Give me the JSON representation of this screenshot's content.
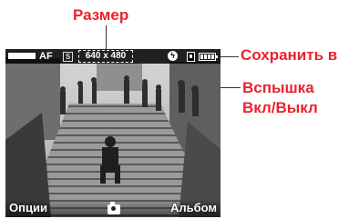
{
  "callouts": {
    "size": "Размер",
    "save_to": "Сохранить в",
    "flash_line1": "Вспышка",
    "flash_line2": "Вкл/Выкл"
  },
  "viewfinder": {
    "top_bar": {
      "focus_mode": "AF",
      "scene_mode_icon": "S",
      "resolution": "640 x 480",
      "flash_icon": "ϟ",
      "memory_icon": "memory-card-icon",
      "battery_icon": "battery-icon"
    },
    "softkeys": {
      "left": "Опции",
      "center_icon": "camera-icon",
      "right": "Альбом"
    }
  },
  "colors": {
    "callout": "#e8232f",
    "overlay": "#000000"
  }
}
